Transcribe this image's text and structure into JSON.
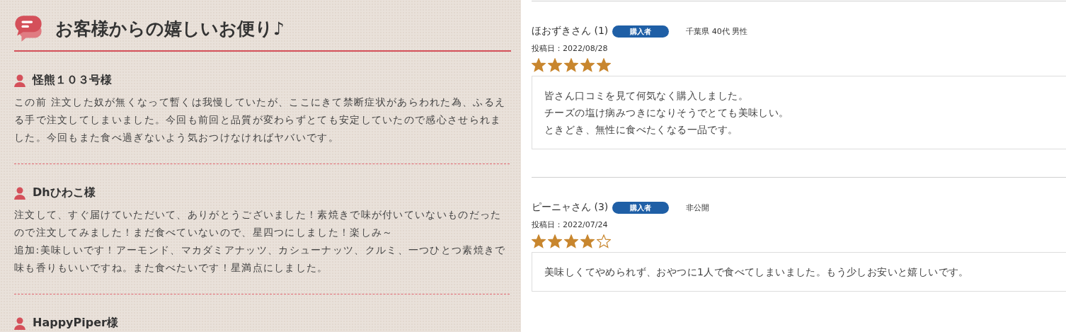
{
  "voices": {
    "title": "お客様からの嬉しいお便り♪",
    "reviews": [
      {
        "name": "怪熊１０３号様",
        "body": [
          "この前 注文した奴が無くなって暫くは我慢していたが、ここにきて禁断症状があらわれた為、ふるえる手で注文してしまいました。今回も前回と品質が変わらずとても安定していたので感心させられました。今回もまた食べ過ぎないよう気おつけなければヤバいです。"
        ]
      },
      {
        "name": "Dhひわこ様",
        "body": [
          "注文して、すぐ届けていただいて、ありがとうございました！素焼きで味が付いていないものだったので注文してみました！まだ食べていないので、星四つにしました！楽しみ～",
          "追加:美味しいです！アーモンド、マカダミアナッツ、カシューナッツ、クルミ、一つひとつ素焼きで味も香りもいいですね。また食べたいです！星満点にしました。"
        ]
      },
      {
        "name": "HappyPiper様"
      }
    ]
  },
  "reviews": [
    {
      "name": "ほおずきさん (1)",
      "badge": "購入者",
      "profile": "千葉県 40代 男性",
      "date": "投稿日：2022/08/28",
      "stars": 5,
      "body": [
        "皆さん口コミを見て何気なく購入しました。",
        "チーズの塩け病みつきになりそうでとても美味しい。",
        "ときどき、無性に食べたくなる一品です。"
      ]
    },
    {
      "name": "ピーニャさん (3)",
      "badge": "購入者",
      "profile": "非公開",
      "date": "投稿日：2022/07/24",
      "stars": 4,
      "body": [
        "美味しくてやめられず、おやつに1人で食べてしまいました。もう少しお安いと嬉しいです。"
      ]
    }
  ]
}
